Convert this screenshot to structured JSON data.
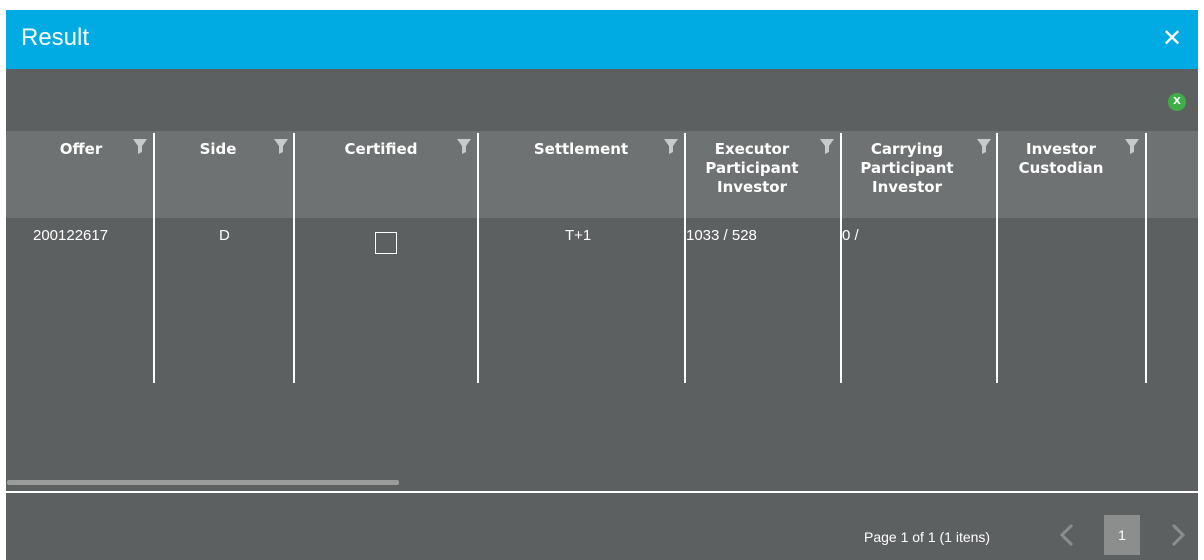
{
  "dialog": {
    "title": "Result",
    "close_icon": "close-icon",
    "excel_icon": "excel-export-icon",
    "excel_glyph": "X"
  },
  "grid": {
    "columns": [
      {
        "label": "Offer"
      },
      {
        "label": "Side"
      },
      {
        "label": "Certified"
      },
      {
        "label": "Settlement"
      },
      {
        "label": "Executor Participant Investor"
      },
      {
        "label": "Carrying Participant Investor"
      },
      {
        "label": "Investor Custodian"
      }
    ],
    "rows": [
      {
        "offer": "200122617",
        "side": "D",
        "certified": false,
        "settlement": "T+1",
        "executor": "1033 / 528",
        "carrying": "0 /",
        "custodian": ""
      }
    ]
  },
  "pager": {
    "summary": "Page 1 of 1 (1 itens)",
    "current_page": "1"
  }
}
